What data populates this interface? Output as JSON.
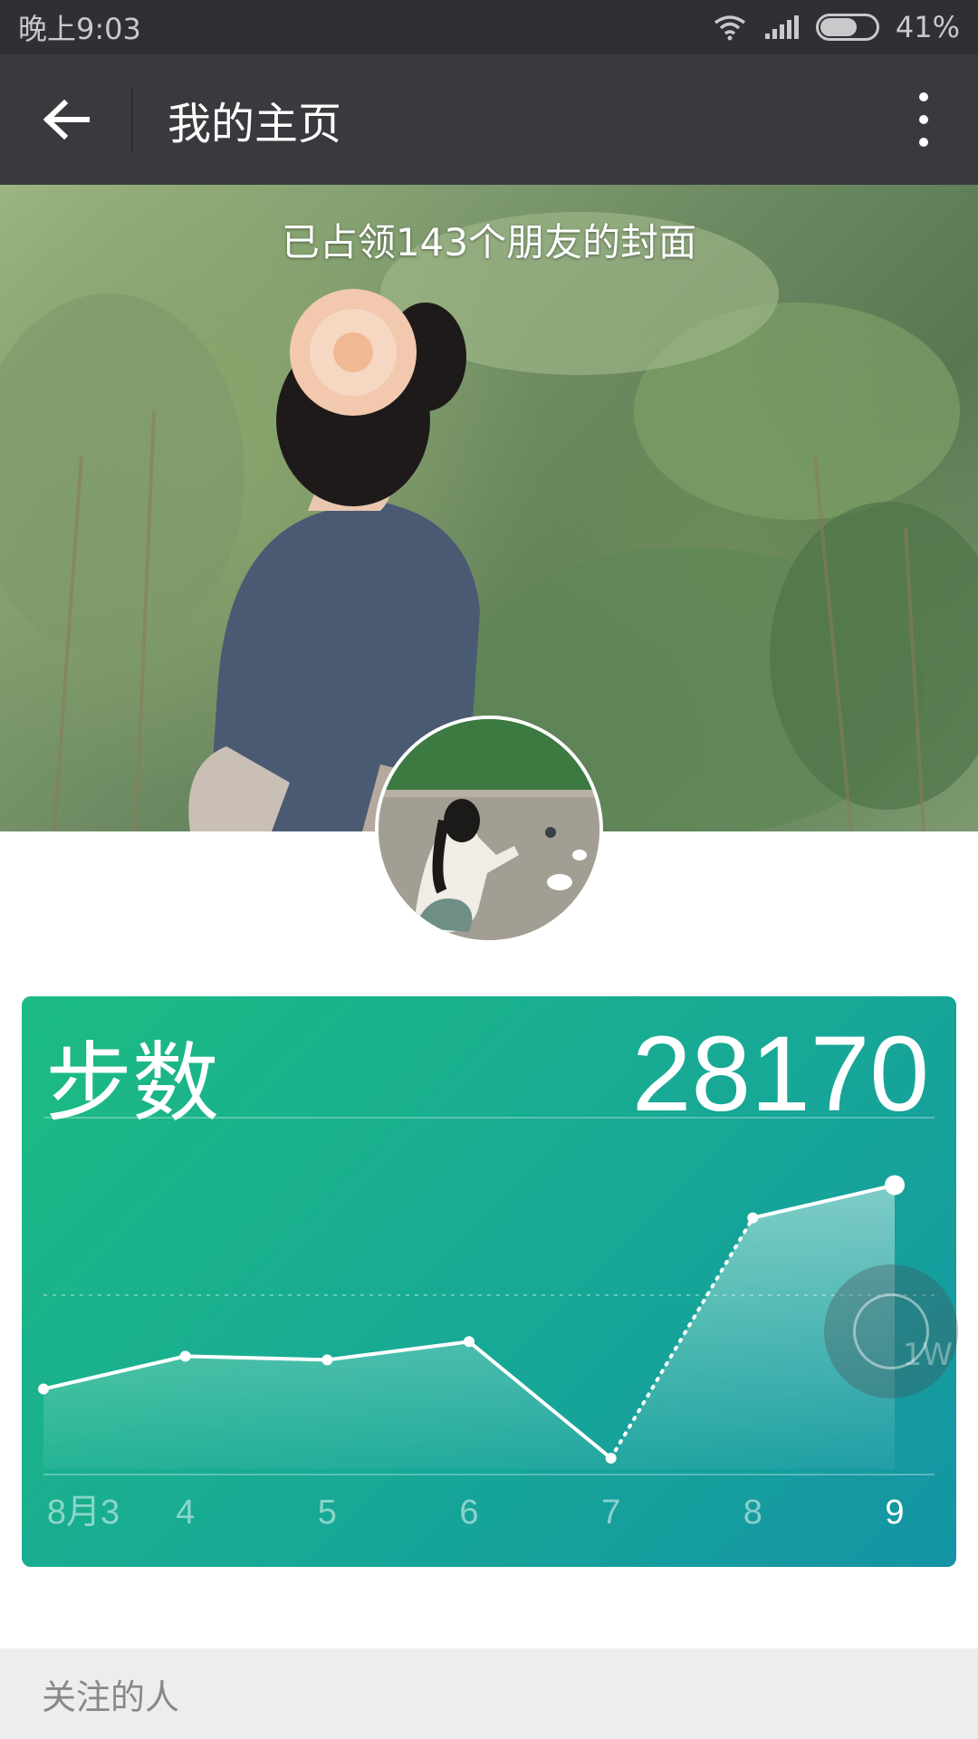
{
  "status_bar": {
    "time": "晚上9:03",
    "battery": "41%",
    "battery_level": 0.41,
    "icons": [
      "wifi-icon",
      "signal-icon",
      "battery-icon"
    ]
  },
  "app_bar": {
    "title": "我的主页",
    "back_icon": "arrow-left-icon",
    "more_icon": "more-vertical-icon"
  },
  "cover": {
    "caption": "已占领143个朋友的封面"
  },
  "steps_card": {
    "label": "步数",
    "value": "28170",
    "float_button_label": "1W"
  },
  "chart_data": {
    "type": "line",
    "categories": [
      "8月3",
      "4",
      "5",
      "6",
      "7",
      "8",
      "9"
    ],
    "series": [
      {
        "values": [
          0.22,
          0.31,
          0.3,
          0.35,
          0.03,
          0.69,
          0.78
        ]
      }
    ],
    "highlighted_category": "9",
    "colors": {
      "accent_start": "#1dbb83",
      "accent_end": "#1494a4"
    }
  },
  "following": {
    "header": "关注的人"
  }
}
